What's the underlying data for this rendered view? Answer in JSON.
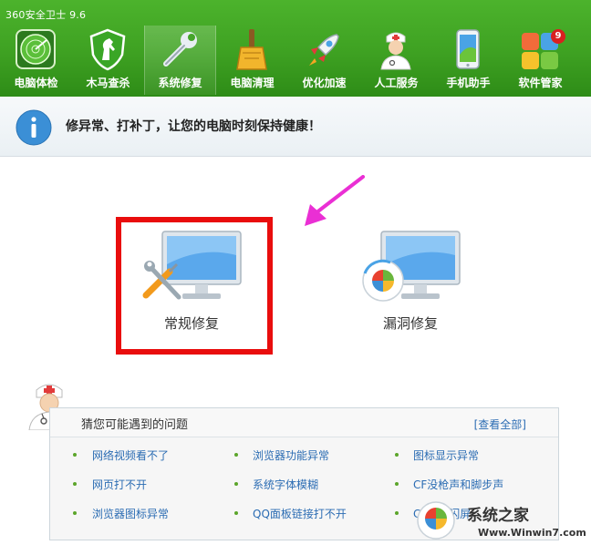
{
  "app": {
    "title": "360安全卫士 9.6"
  },
  "toolbar": {
    "items": [
      {
        "label": "电脑体检",
        "icon": "radar-icon"
      },
      {
        "label": "木马查杀",
        "icon": "horse-shield-icon"
      },
      {
        "label": "系统修复",
        "icon": "wrench-icon",
        "active": true
      },
      {
        "label": "电脑清理",
        "icon": "broom-icon"
      },
      {
        "label": "优化加速",
        "icon": "rocket-icon"
      },
      {
        "label": "人工服务",
        "icon": "doctor-icon"
      },
      {
        "label": "手机助手",
        "icon": "phone-icon"
      },
      {
        "label": "软件管家",
        "icon": "software-grid-icon",
        "badge": "9"
      }
    ]
  },
  "banner": {
    "text": "修异常、打补丁，让您的电脑时刻保持健康！",
    "icon": "info-icon"
  },
  "repair_options": [
    {
      "label": "常规修复",
      "icon": "monitor-tools-icon",
      "highlighted": true
    },
    {
      "label": "漏洞修复",
      "icon": "monitor-windows-icon"
    }
  ],
  "problems": {
    "title": "猜您可能遇到的问题",
    "view_all": "[查看全部]",
    "items": [
      "网络视频看不了",
      "浏览器功能异常",
      "图标显示异常",
      "网页打不开",
      "系统字体模糊",
      "CF没枪声和脚步声",
      "浏览器图标异常",
      "QQ面板链接打不开",
      "CF画面闪屏"
    ]
  },
  "watermark": {
    "title": "系统之家",
    "url": "Www.Winwin7.com"
  },
  "colors": {
    "topbar": "#3ea122",
    "highlight": "#e90d0d",
    "arrow": "#ea2fd4",
    "link": "#2b6cb3"
  }
}
